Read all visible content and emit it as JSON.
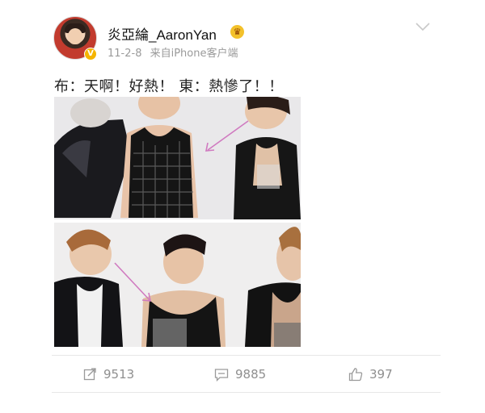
{
  "post": {
    "username": "炎亞綸_AaronYan",
    "date": "11-2-8",
    "source": "来自iPhone客户端",
    "text": "布：天啊！好熱！ 東：熱慘了！！"
  },
  "actions": {
    "repost_count": "9513",
    "comment_count": "9885",
    "like_count": "397"
  },
  "colors": {
    "accent_badge": "#f5b400",
    "text_muted": "#9a9a9a",
    "divider": "#e7e7e7",
    "arrow": "#d07ac0"
  },
  "icons": {
    "more": "chevron-down-icon",
    "repost": "repost-icon",
    "comment": "comment-icon",
    "like": "thumbs-up-icon",
    "verified": "verified-badge-icon",
    "member": "member-crown-icon"
  }
}
